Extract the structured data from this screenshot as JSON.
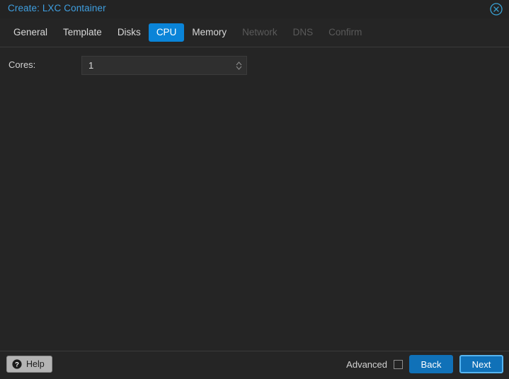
{
  "window": {
    "title": "Create: LXC Container",
    "close_icon": "close-circle-icon"
  },
  "tabs": [
    {
      "label": "General",
      "state": "enabled"
    },
    {
      "label": "Template",
      "state": "enabled"
    },
    {
      "label": "Disks",
      "state": "enabled"
    },
    {
      "label": "CPU",
      "state": "active"
    },
    {
      "label": "Memory",
      "state": "enabled"
    },
    {
      "label": "Network",
      "state": "disabled"
    },
    {
      "label": "DNS",
      "state": "disabled"
    },
    {
      "label": "Confirm",
      "state": "disabled"
    }
  ],
  "form": {
    "cores": {
      "label": "Cores:",
      "value": "1",
      "placeholder": ""
    }
  },
  "footer": {
    "help_label": "Help",
    "help_icon": "question-circle-icon",
    "advanced_label": "Advanced",
    "advanced_checked": false,
    "back_label": "Back",
    "next_label": "Next"
  },
  "colors": {
    "accent": "#0a84d8",
    "button": "#1071b8",
    "focus_ring": "#56b4f0",
    "title": "#3f9fe0",
    "background": "#252525",
    "panel": "#232323",
    "input": "#2f2f2f",
    "disabled_text": "#5a5a5a"
  }
}
